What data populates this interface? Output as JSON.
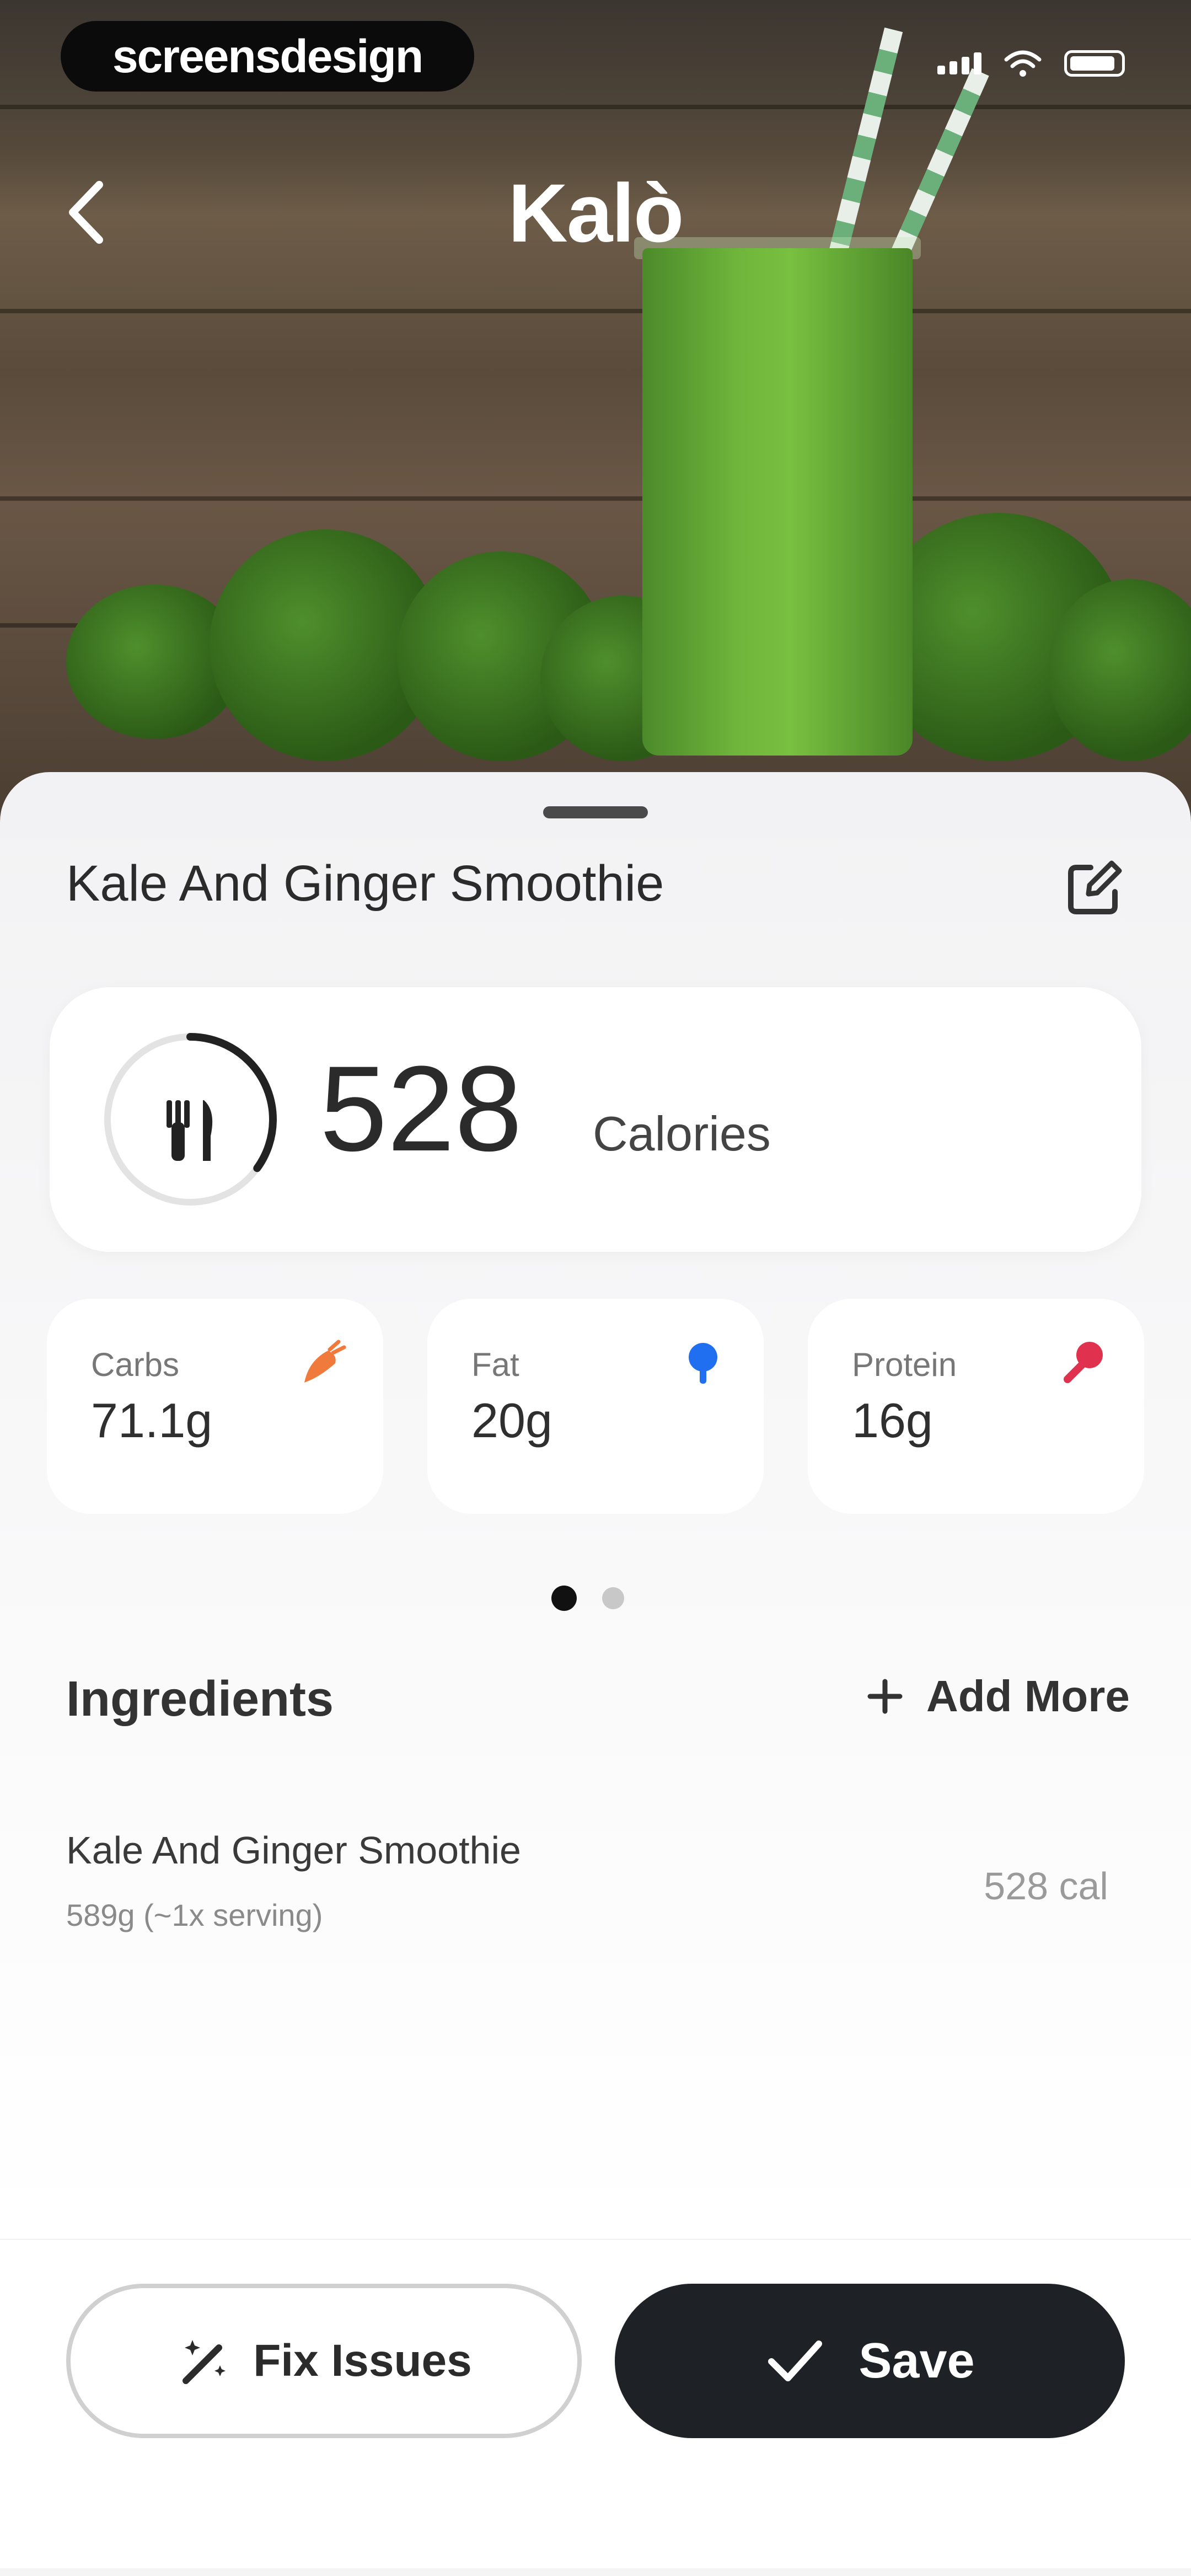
{
  "status_bar": {
    "brand": "screensdesign"
  },
  "header": {
    "title": "Kalò"
  },
  "food": {
    "name": "Kale And Ginger Smoothie"
  },
  "calories": {
    "value": "528",
    "label": "Calories",
    "progress": 0.35
  },
  "macros": [
    {
      "label": "Carbs",
      "value": "71.1g",
      "icon": "carrot-icon",
      "color": "#f07a3c"
    },
    {
      "label": "Fat",
      "value": "20g",
      "icon": "droplet-icon",
      "color": "#1f6ff0"
    },
    {
      "label": "Protein",
      "value": "16g",
      "icon": "drumstick-icon",
      "color": "#e0324e"
    }
  ],
  "pager": {
    "pages": 2,
    "active": 1
  },
  "ingredients": {
    "title": "Ingredients",
    "add_more": "Add More",
    "items": [
      {
        "name": "Kale And Ginger Smoothie",
        "detail": "589g (~1x serving)",
        "calories": "528 cal"
      }
    ]
  },
  "actions": {
    "fix": "Fix Issues",
    "save": "Save"
  }
}
